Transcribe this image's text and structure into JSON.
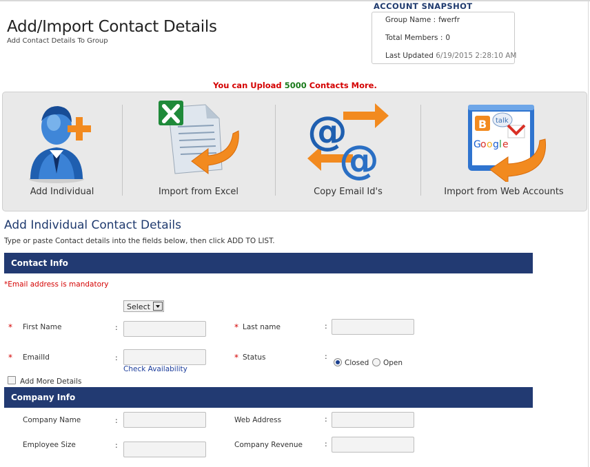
{
  "header": {
    "title": "Add/Import Contact Details",
    "subtitle": "Add Contact Details To Group"
  },
  "snapshot": {
    "title": "ACCOUNT SNAPSHOT",
    "group_name_label": "Group Name :",
    "group_name_value": "fwerfr",
    "total_members_label": "Total Members :",
    "total_members_value": "0",
    "last_updated_label": "Last Updated",
    "last_updated_value": "6/19/2015 2:28:10 AM"
  },
  "upload": {
    "prefix": "You can Upload",
    "count": "5000",
    "suffix": "Contacts More."
  },
  "tools": [
    {
      "label": "Add Individual",
      "icon": "person-add-icon"
    },
    {
      "label": "Import from Excel",
      "icon": "excel-import-icon"
    },
    {
      "label": "Copy Email Id's",
      "icon": "email-copy-icon"
    },
    {
      "label": "Import from Web Accounts",
      "icon": "web-accounts-icon"
    }
  ],
  "section": {
    "heading": "Add Individual Contact Details",
    "instructions": "Type or paste Contact details into the fields below, then click ADD TO LIST."
  },
  "contact_info": {
    "title": "Contact Info",
    "mandatory_note": "*Email address is mandatory",
    "title_select_value": "Select",
    "first_name_label": "First Name",
    "last_name_label": "Last name",
    "email_label": "EmailId",
    "status_label": "Status",
    "check_availability": "Check Availability",
    "status_options": [
      "Closed",
      "Open"
    ],
    "status_selected": "Closed",
    "add_more_details": "Add More Details",
    "required_mark": "*",
    "colon": ":"
  },
  "company_info": {
    "title": "Company Info",
    "company_name_label": "Company Name",
    "web_address_label": "Web Address",
    "employee_size_label": "Employee Size",
    "company_revenue_label": "Company Revenue"
  },
  "colors": {
    "band": "#223a72",
    "heading": "#1f3a6e",
    "required": "#d40000",
    "upload_count": "#1a7a1a"
  }
}
